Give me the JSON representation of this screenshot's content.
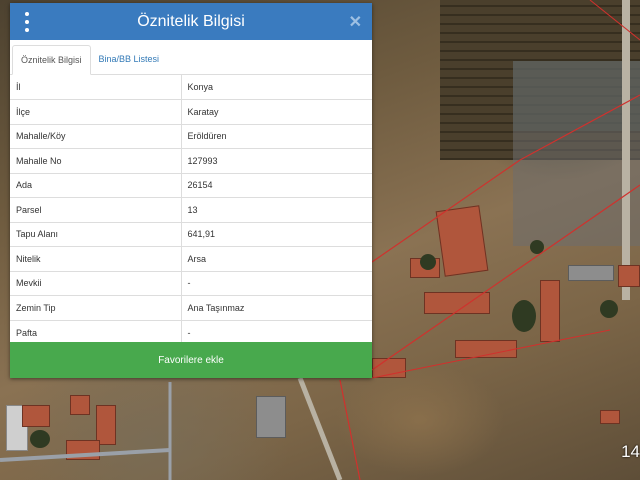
{
  "panel": {
    "title": "Öznitelik Bilgisi",
    "tabs": [
      {
        "label": "Öznitelik Bilgisi",
        "active": true
      },
      {
        "label": "Bina/BB Listesi",
        "active": false
      }
    ],
    "rows": [
      {
        "key": "İl",
        "value": "Konya"
      },
      {
        "key": "İlçe",
        "value": "Karatay"
      },
      {
        "key": "Mahalle/Köy",
        "value": "Eröldüren"
      },
      {
        "key": "Mahalle No",
        "value": "127993"
      },
      {
        "key": "Ada",
        "value": "26154"
      },
      {
        "key": "Parsel",
        "value": "13"
      },
      {
        "key": "Tapu Alanı",
        "value": "641,91"
      },
      {
        "key": "Nitelik",
        "value": "Arsa"
      },
      {
        "key": "Mevkii",
        "value": "-"
      },
      {
        "key": "Zemin Tip",
        "value": "Ana Taşınmaz"
      },
      {
        "key": "Pafta",
        "value": "-"
      }
    ],
    "favorite_button": "Favorilere ekle",
    "icons": {
      "menu": "vertical-dots-icon",
      "close": "close-icon"
    },
    "colors": {
      "header": "#3a7bbf",
      "button": "#48a94d",
      "link": "#337ab7"
    }
  },
  "map": {
    "zoom_level": "14",
    "parcel_line_color": "#d0312d"
  }
}
